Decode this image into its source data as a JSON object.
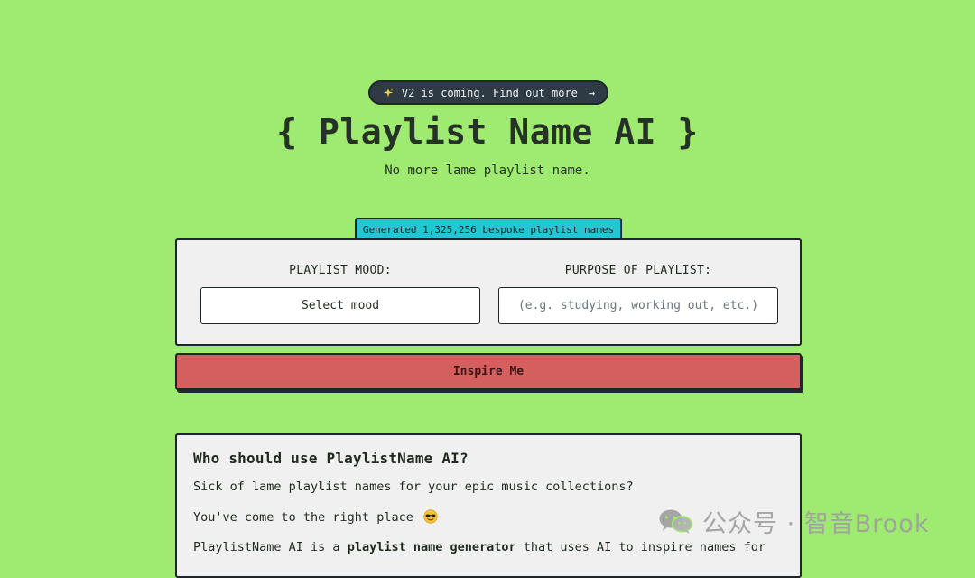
{
  "announcement": {
    "text": "V2 is coming. Find out more",
    "arrow": "→",
    "icon": "sparkle-icon"
  },
  "header": {
    "title": "{ Playlist Name AI }",
    "subtitle": "No more lame playlist name."
  },
  "counter": {
    "text": "Generated 1,325,256 bespoke playlist names",
    "color": "#22c7d4"
  },
  "form": {
    "mood_label": "PLAYLIST MOOD:",
    "mood_value": "Select mood",
    "purpose_label": "PURPOSE OF PLAYLIST:",
    "purpose_placeholder": "(e.g. studying, working out, etc.)",
    "purpose_value": ""
  },
  "cta": {
    "label": "Inspire Me",
    "color": "#d55f5e"
  },
  "info": {
    "title": "Who should use PlaylistName AI?",
    "line1": "Sick of lame playlist names for your epic music collections?",
    "line2": "You've come to the right place",
    "line2_emoji": "sunglasses-emoji-icon",
    "line3_prefix": "PlaylistName AI is a ",
    "line3_bold": "playlist name generator",
    "line3_suffix": " that uses AI to inspire names for"
  },
  "watermark": {
    "text": "公众号 · 智音Brook",
    "icon": "wechat-icon"
  },
  "colors": {
    "background": "#9fea70",
    "card": "#f0f0f0",
    "border": "#1e262b",
    "announcement_bg": "#2e3b44"
  }
}
